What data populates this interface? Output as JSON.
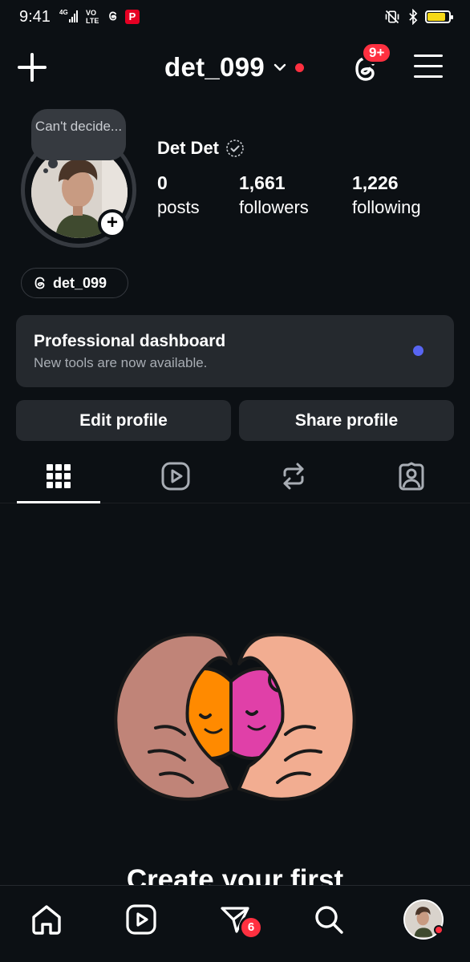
{
  "status_bar": {
    "time": "9:41",
    "signal": "4G",
    "volte": "VO\nLTE",
    "icons": [
      "threads-icon",
      "pinterest-icon",
      "vibrate-icon",
      "bluetooth-icon",
      "battery-icon"
    ],
    "battery_level": 0.85,
    "battery_color": "#f7d917"
  },
  "header": {
    "username": "det_099",
    "notification_badge": "9+",
    "accent_red": "#ff3040"
  },
  "profile": {
    "note": "Can't decide...",
    "display_name": "Det Det",
    "add_story_symbol": "+",
    "stats": [
      {
        "value": "0",
        "label": "posts"
      },
      {
        "value": "1,661",
        "label": "followers"
      },
      {
        "value": "1,226",
        "label": "following"
      }
    ],
    "threads_handle": "det_099"
  },
  "dashboard": {
    "title": "Professional dashboard",
    "subtitle": "New tools are now available.",
    "dot_color": "#5865f2"
  },
  "buttons": {
    "edit": "Edit profile",
    "share": "Share profile"
  },
  "tabs": [
    "grid-icon",
    "reels-icon",
    "reposts-icon",
    "tagged-icon"
  ],
  "empty_state": {
    "title": "Create your first"
  },
  "bottom_nav": {
    "items": [
      "home-icon",
      "reels-icon",
      "messages-icon",
      "search-icon",
      "profile-avatar"
    ],
    "messages_badge": "6"
  }
}
